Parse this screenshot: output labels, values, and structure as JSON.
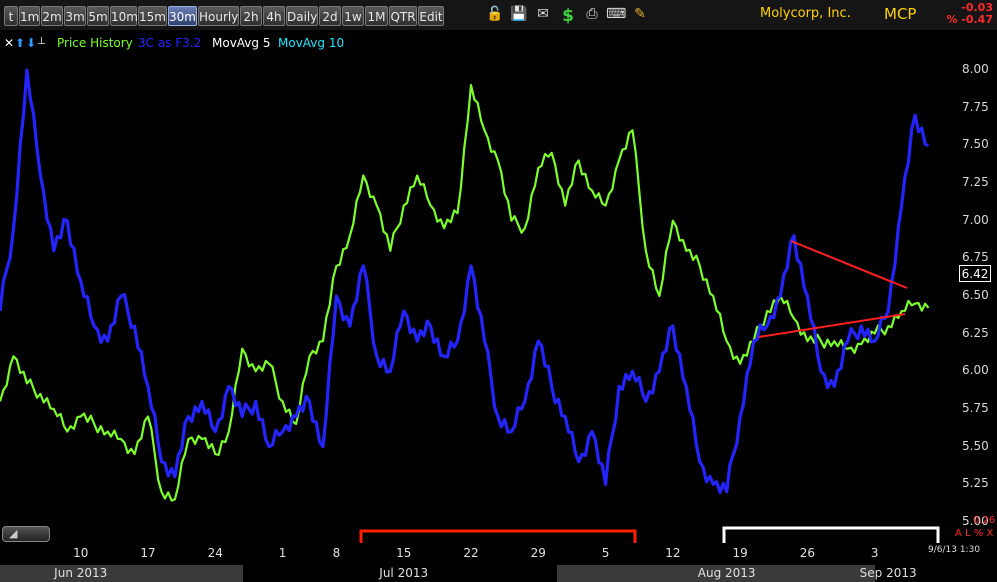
{
  "toolbar": {
    "buttons": [
      "t",
      "1m",
      "2m",
      "3m",
      "5m",
      "10m",
      "15m",
      "30m",
      "Hourly",
      "2h",
      "4h",
      "Daily",
      "2d",
      "1w",
      "1M",
      "QTR",
      "Edit"
    ],
    "active": "30m",
    "icons": [
      "lock-icon",
      "save-icon",
      "mail-icon",
      "dollar-icon",
      "print-icon",
      "keyboard-icon",
      "pencil-icon"
    ]
  },
  "header": {
    "company": "Molycorp, Inc.",
    "ticker": "MCP",
    "change": "-0.03",
    "change_pct": "% -0.47"
  },
  "legend": {
    "items": [
      {
        "label": "Price History",
        "color": "#7cff2a"
      },
      {
        "label": "3C as F3.2",
        "color": "#2424ff"
      },
      {
        "label": "MovAvg 5",
        "color": "#ffffff"
      },
      {
        "label": "MovAvg 10",
        "color": "#22e6ff"
      }
    ],
    "color_up_arrow": "#2a9bff"
  },
  "right_panel": {
    "current_price": "6.42",
    "small_value": "0.26",
    "small_marker": "A L % X",
    "timestamp": "9/6/13 1:30"
  },
  "colors": {
    "price": "#7cff2a",
    "indicator": "#2424ff",
    "trendline": "#ff2020",
    "highlight_red": "#ff2000",
    "highlight_white": "#ffffff",
    "ma_cyan": "#22e6ff"
  },
  "chart_data": {
    "type": "line",
    "title": "",
    "y_ticks": [
      "8.00",
      "7.75",
      "7.50",
      "7.25",
      "7.00",
      "6.75",
      "6.50",
      "6.25",
      "6.00",
      "5.75",
      "5.50",
      "5.25",
      "5.00"
    ],
    "ylim": [
      4.88,
      8.1
    ],
    "x_ticks": [
      {
        "label": "10",
        "x": 6
      },
      {
        "label": "17",
        "x": 11
      },
      {
        "label": "24",
        "x": 16
      },
      {
        "label": "1",
        "x": 21
      },
      {
        "label": "8",
        "x": 25
      },
      {
        "label": "15",
        "x": 30
      },
      {
        "label": "22",
        "x": 35
      },
      {
        "label": "29",
        "x": 40
      },
      {
        "label": "5",
        "x": 45
      },
      {
        "label": "12",
        "x": 50
      },
      {
        "label": "19",
        "x": 55
      },
      {
        "label": "26",
        "x": 60
      },
      {
        "label": "3",
        "x": 65
      }
    ],
    "month_labels": [
      {
        "label": "Jun 2013",
        "x": 6
      },
      {
        "label": "Jul 2013",
        "x": 30
      },
      {
        "label": "Aug 2013",
        "x": 54
      },
      {
        "label": "Sep 2013",
        "x": 66
      }
    ],
    "xlim": [
      0,
      70
    ],
    "series": [
      {
        "name": "Price History",
        "color": "#7cff2a",
        "x": [
          0,
          1,
          2,
          3,
          4,
          5,
          6,
          7,
          8,
          9,
          10,
          11,
          12,
          13,
          14,
          15,
          16,
          17,
          18,
          19,
          20,
          21,
          22,
          23,
          24,
          25,
          26,
          27,
          28,
          29,
          30,
          31,
          32,
          33,
          34,
          35,
          36,
          37,
          38,
          39,
          40,
          41,
          42,
          43,
          44,
          45,
          46,
          47,
          48,
          49,
          50,
          51,
          52,
          53,
          54,
          55,
          56,
          57,
          58,
          59,
          60,
          61,
          62,
          63,
          64,
          65,
          66,
          67,
          68,
          69
        ],
        "values": [
          5.8,
          6.1,
          5.92,
          5.85,
          5.75,
          5.6,
          5.7,
          5.65,
          5.6,
          5.55,
          5.45,
          5.7,
          5.2,
          5.15,
          5.55,
          5.55,
          5.45,
          5.6,
          6.15,
          6.0,
          6.05,
          5.8,
          5.65,
          6.1,
          6.2,
          6.7,
          6.9,
          7.3,
          7.1,
          6.8,
          7.1,
          7.3,
          7.1,
          6.95,
          7.05,
          7.9,
          7.6,
          7.4,
          7.0,
          6.95,
          7.35,
          7.45,
          7.1,
          7.4,
          7.2,
          7.1,
          7.4,
          7.6,
          6.8,
          6.5,
          7.0,
          6.8,
          6.7,
          6.5,
          6.2,
          6.05,
          6.2,
          6.4,
          6.5,
          6.35,
          6.2,
          6.2,
          6.2,
          6.15,
          6.18,
          6.25,
          6.3,
          6.4,
          6.45,
          6.42
        ]
      },
      {
        "name": "3C as F3.2",
        "color": "#2424ff",
        "x": [
          0,
          1,
          2,
          3,
          4,
          5,
          6,
          7,
          8,
          9,
          10,
          11,
          12,
          13,
          14,
          15,
          16,
          17,
          18,
          19,
          20,
          21,
          22,
          23,
          24,
          25,
          26,
          27,
          28,
          29,
          30,
          31,
          32,
          33,
          34,
          35,
          36,
          37,
          38,
          39,
          40,
          41,
          42,
          43,
          44,
          45,
          46,
          47,
          48,
          49,
          50,
          51,
          52,
          53,
          54,
          55,
          56,
          57,
          58,
          59,
          60,
          61,
          62,
          63,
          64,
          65,
          66,
          67,
          68,
          69
        ],
        "values": [
          6.4,
          6.95,
          8.0,
          7.3,
          6.8,
          7.0,
          6.6,
          6.3,
          6.2,
          6.5,
          6.3,
          5.9,
          5.4,
          5.3,
          5.7,
          5.8,
          5.6,
          5.9,
          5.7,
          5.8,
          5.5,
          5.6,
          5.7,
          5.8,
          5.5,
          6.5,
          6.3,
          6.7,
          6.1,
          6.0,
          6.4,
          6.2,
          6.3,
          6.1,
          6.2,
          6.7,
          6.2,
          5.7,
          5.6,
          5.8,
          6.2,
          5.9,
          5.7,
          5.4,
          5.6,
          5.25,
          5.9,
          6.0,
          5.8,
          6.0,
          6.3,
          5.9,
          5.4,
          5.25,
          5.2,
          5.7,
          6.2,
          6.3,
          6.5,
          6.9,
          6.5,
          6.0,
          5.9,
          6.2,
          6.3,
          6.2,
          6.4,
          7.1,
          7.7,
          7.5
        ]
      }
    ]
  }
}
